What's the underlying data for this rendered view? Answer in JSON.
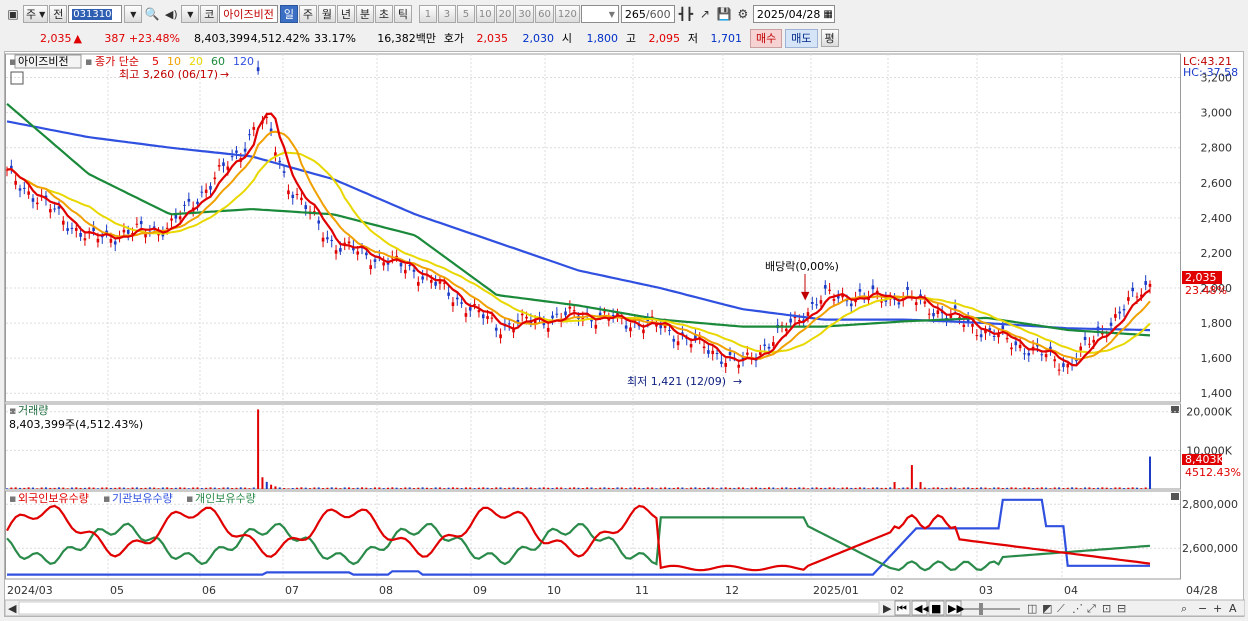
{
  "toolbar": {
    "market_label": "주",
    "prev_label": "전",
    "stock_code": "031310",
    "code_prefix": "코",
    "stock_name": "아이즈비전",
    "periods": [
      "일",
      "주",
      "월",
      "년",
      "분",
      "초",
      "틱"
    ],
    "selected_period": "일",
    "intervals": [
      "1",
      "3",
      "5",
      "10",
      "20",
      "30",
      "60",
      "120"
    ],
    "count_value": "265",
    "count_total": "/600",
    "date": "2025/04/28"
  },
  "quote": {
    "price": "2,035",
    "change_arrow": "▲",
    "change": "387",
    "change_pct": "+23.48%",
    "volume": "8,403,399",
    "volume_pct": "4,512.42%",
    "turnover_pct": "33.17%",
    "amount": "16,382백만",
    "ask_label": "호가",
    "ask": "2,035",
    "bid": "2,030",
    "open_label": "시",
    "open": "1,800",
    "high_label": "고",
    "high": "2,095",
    "low_label": "저",
    "low": "1,701",
    "buy_label": "매수",
    "sell_label": "매도",
    "eval_label": "평"
  },
  "price_panel": {
    "tab_name": "아이즈비전",
    "legend_prefix": "종가 단순",
    "ma_periods": [
      "5",
      "10",
      "20",
      "60",
      "120"
    ],
    "ma_colors": [
      "#e00000",
      "#f0a000",
      "#e8d800",
      "#1a8a3a",
      "#3050e0"
    ],
    "high_note": "최고 3,260 (06/17)",
    "low_note": "최저 1,421 (12/09)",
    "dividend_note": "배당락(0,00%)",
    "lc_label": "LC:43.21",
    "hc_label": "HC:-37.58",
    "last_price_tag": "2,035",
    "last_pct_tag": "23.48%",
    "y_ticks": [
      "3,200",
      "3,000",
      "2,800",
      "2,600",
      "2,400",
      "2,200",
      "2,000",
      "1,800",
      "1,600",
      "1,400"
    ]
  },
  "volume_panel": {
    "title": "거래량",
    "value_text": "8,403,399주(4,512.43%)",
    "y_ticks": [
      "20,000K",
      "10,000K"
    ],
    "last_tag": "8,403K",
    "last_pct": "4512.43%"
  },
  "holder_panel": {
    "series": [
      "외국인보유수량",
      "기관보유수량",
      "개인보유수량"
    ],
    "series_colors": [
      "#e00000",
      "#3050e0",
      "#2a8a4a"
    ],
    "y_ticks": [
      "2,800,000",
      "2,600,000"
    ]
  },
  "x_axis": {
    "labels": [
      "2024/03",
      "05",
      "06",
      "07",
      "08",
      "09",
      "10",
      "11",
      "12",
      "2025/01",
      "02",
      "03",
      "04",
      "04/28"
    ]
  },
  "chart_data": {
    "type": "line",
    "title": "",
    "ylim": [
      1350,
      3300
    ],
    "x": [
      "2024/03",
      "2024/04",
      "2024/05",
      "2024/06",
      "2024/07",
      "2024/08",
      "2024/09",
      "2024/10",
      "2024/11",
      "2024/12",
      "2025/01",
      "2025/02",
      "2025/03",
      "2025/04",
      "2025/04/28"
    ],
    "series": [
      {
        "name": "5",
        "values": [
          2650,
          2280,
          2350,
          2850,
          2250,
          2100,
          1780,
          1850,
          1780,
          1560,
          1950,
          1950,
          1750,
          1560,
          2035
        ]
      },
      {
        "name": "120",
        "values": [
          2950,
          2860,
          2800,
          2750,
          2620,
          2420,
          2260,
          2100,
          2000,
          1880,
          1820,
          1820,
          1800,
          1770,
          1760
        ]
      },
      {
        "name": "60",
        "values": [
          3050,
          2650,
          2420,
          2450,
          2420,
          2300,
          1960,
          1900,
          1820,
          1780,
          1780,
          1810,
          1830,
          1760,
          1730
        ]
      }
    ]
  },
  "status_bar": {
    "icons": [
      "play-icon",
      "rewind-icon",
      "back-icon",
      "stop-icon",
      "forward-icon",
      "zoom-slider",
      "search-icon",
      "minus-icon",
      "plus-icon",
      "text-icon"
    ]
  }
}
